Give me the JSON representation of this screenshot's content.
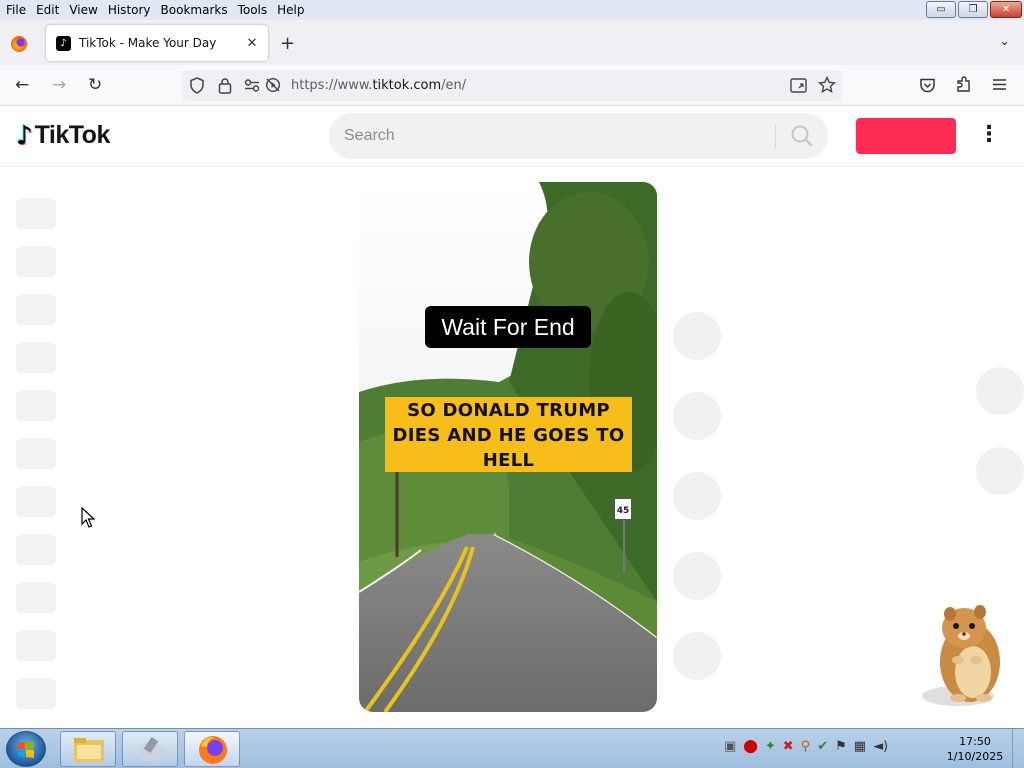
{
  "menubar": {
    "items": [
      "File",
      "Edit",
      "View",
      "History",
      "Bookmarks",
      "Tools",
      "Help"
    ]
  },
  "window_controls": {
    "minimize": "▭",
    "restore": "❐",
    "close": "✕"
  },
  "tab": {
    "title": "TikTok - Make Your Day",
    "favicon": "♪",
    "close": "✕"
  },
  "tabbar": {
    "new_tab": "+",
    "list_tabs": "⌄"
  },
  "navbar": {
    "back": "←",
    "forward": "→",
    "reload": "↻",
    "url_prefix": "https://www.",
    "url_domain": "tiktok.com",
    "url_suffix": "/en/"
  },
  "tiktok": {
    "logo_text": "TikTok",
    "logo_note": "♪",
    "search_placeholder": "Search",
    "login_label": "",
    "more": "⋮"
  },
  "video": {
    "overlay_label": "Wait For End",
    "caption_line1": "SO DONALD TRUMP",
    "caption_line2": "DIES AND HE GOES TO",
    "caption_line3": "HELL",
    "speed_sign": "45"
  },
  "clock": {
    "time": "17:50",
    "date": "1/10/2025"
  },
  "colors": {
    "tiktok_red": "#fe2c55",
    "caption_bg": "#f7bd1b",
    "taskbar": "#a9c6e6"
  }
}
